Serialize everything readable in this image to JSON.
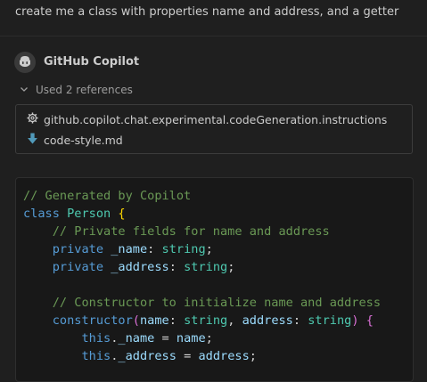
{
  "user_message": "create me a class with properties name and address, and a getter",
  "response": {
    "author": "GitHub Copilot",
    "avatar_icon": "copilot-icon"
  },
  "references": {
    "toggle_label": "Used 2 references",
    "items": [
      {
        "icon": "gear-icon",
        "label": "github.copilot.chat.experimental.codeGeneration.instructions"
      },
      {
        "icon": "markdown-file-icon",
        "label": "code-style.md"
      }
    ]
  },
  "code": {
    "language": "typescript",
    "lines": [
      [
        {
          "t": "// Generated by Copilot",
          "c": "cm"
        }
      ],
      [
        {
          "t": "class",
          "c": "kw"
        },
        {
          "t": " ",
          "c": "pl"
        },
        {
          "t": "Person",
          "c": "ty"
        },
        {
          "t": " ",
          "c": "pl"
        },
        {
          "t": "{",
          "c": "by"
        }
      ],
      [
        {
          "t": "    // Private fields for name and address",
          "c": "cm"
        }
      ],
      [
        {
          "t": "    ",
          "c": "pl"
        },
        {
          "t": "private",
          "c": "kw"
        },
        {
          "t": " ",
          "c": "pl"
        },
        {
          "t": "_name",
          "c": "pr"
        },
        {
          "t": ": ",
          "c": "pl"
        },
        {
          "t": "string",
          "c": "ty"
        },
        {
          "t": ";",
          "c": "pl"
        }
      ],
      [
        {
          "t": "    ",
          "c": "pl"
        },
        {
          "t": "private",
          "c": "kw"
        },
        {
          "t": " ",
          "c": "pl"
        },
        {
          "t": "_address",
          "c": "pr"
        },
        {
          "t": ": ",
          "c": "pl"
        },
        {
          "t": "string",
          "c": "ty"
        },
        {
          "t": ";",
          "c": "pl"
        }
      ],
      [
        {
          "t": "",
          "c": "pl"
        }
      ],
      [
        {
          "t": "    // Constructor to initialize name and address",
          "c": "cm"
        }
      ],
      [
        {
          "t": "    ",
          "c": "pl"
        },
        {
          "t": "constructor",
          "c": "kw"
        },
        {
          "t": "(",
          "c": "br"
        },
        {
          "t": "name",
          "c": "pr"
        },
        {
          "t": ": ",
          "c": "pl"
        },
        {
          "t": "string",
          "c": "ty"
        },
        {
          "t": ", ",
          "c": "pl"
        },
        {
          "t": "address",
          "c": "pr"
        },
        {
          "t": ": ",
          "c": "pl"
        },
        {
          "t": "string",
          "c": "ty"
        },
        {
          "t": ")",
          "c": "br"
        },
        {
          "t": " ",
          "c": "pl"
        },
        {
          "t": "{",
          "c": "br"
        }
      ],
      [
        {
          "t": "        ",
          "c": "pl"
        },
        {
          "t": "this",
          "c": "kw"
        },
        {
          "t": ".",
          "c": "pl"
        },
        {
          "t": "_name",
          "c": "pr"
        },
        {
          "t": " = ",
          "c": "pl"
        },
        {
          "t": "name",
          "c": "pr"
        },
        {
          "t": ";",
          "c": "pl"
        }
      ],
      [
        {
          "t": "        ",
          "c": "pl"
        },
        {
          "t": "this",
          "c": "kw"
        },
        {
          "t": ".",
          "c": "pl"
        },
        {
          "t": "_address",
          "c": "pr"
        },
        {
          "t": " = ",
          "c": "pl"
        },
        {
          "t": "address",
          "c": "pr"
        },
        {
          "t": ";",
          "c": "pl"
        }
      ]
    ]
  },
  "colors": {
    "background": "#1f1f1f",
    "code_background": "#181818",
    "comment": "#6a9955",
    "keyword": "#569cd6",
    "type": "#4ec9b0",
    "property": "#9cdcfe"
  }
}
